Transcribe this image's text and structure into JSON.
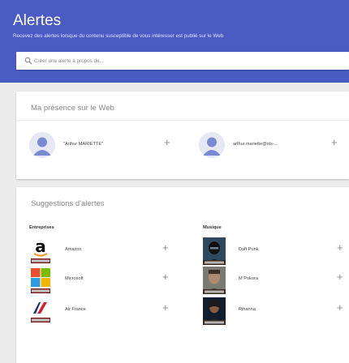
{
  "header": {
    "title": "Alertes",
    "subtitle": "Recevez des alertes lorsque du contenu susceptible de vous intéresser est publié sur le Web",
    "search_placeholder": "Créer une alerte à propos de...",
    "background": "#4a5cc4"
  },
  "presence": {
    "title": "Ma présence sur le Web",
    "items": [
      {
        "label": "\"Arthur MARIETTE\"",
        "icon": "person-avatar-icon",
        "action": "+"
      },
      {
        "label": "arthur.mariette@sts-...",
        "icon": "person-avatar-icon",
        "action": "+"
      }
    ]
  },
  "suggestions": {
    "title": "Suggestions d'alertes",
    "columns": [
      {
        "header": "Entreprises",
        "items": [
          {
            "label": "Amazon",
            "icon": "amazon-logo-icon",
            "action": "+"
          },
          {
            "label": "Microsoft",
            "icon": "microsoft-logo-icon",
            "action": "+"
          },
          {
            "label": "Air France",
            "icon": "air-france-logo-icon",
            "action": "+"
          }
        ]
      },
      {
        "header": "Musique",
        "items": [
          {
            "label": "Daft Punk",
            "icon": "daft-punk-photo-icon",
            "action": "+"
          },
          {
            "label": "M Pokora",
            "icon": "m-pokora-photo-icon",
            "action": "+"
          },
          {
            "label": "Rihanna",
            "icon": "rihanna-photo-icon",
            "action": "+"
          }
        ]
      }
    ]
  },
  "colors": {
    "accent": "#4a5cc4",
    "card": "#ffffff",
    "page": "#ececec"
  }
}
